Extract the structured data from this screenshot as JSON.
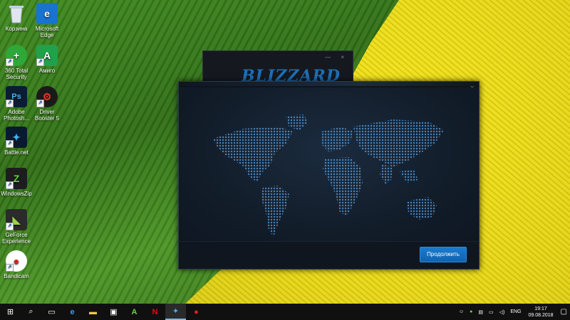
{
  "desktop": {
    "icons": [
      {
        "label": "Корзина",
        "icon": "recycle-bin-icon"
      },
      {
        "label": "Microsoft Edge",
        "icon": "edge-icon"
      },
      {
        "label": "360 Total Security",
        "icon": "360-security-icon"
      },
      {
        "label": "Амиго",
        "icon": "amigo-icon"
      },
      {
        "label": "Adobe Photosh...",
        "icon": "photoshop-icon"
      },
      {
        "label": "Driver Booster 5",
        "icon": "driver-booster-icon"
      },
      {
        "label": "Battle.net",
        "icon": "battlenet-icon"
      },
      {
        "label": "WindowsZip",
        "icon": "windowszip-icon"
      },
      {
        "label": "GeForce Experience",
        "icon": "geforce-icon"
      },
      {
        "label": "Bandicam",
        "icon": "bandicam-icon"
      }
    ]
  },
  "background_window": {
    "logo_text": "BLIZZARD"
  },
  "installer": {
    "close_glyph": "×",
    "continue_label": "Продолжить",
    "accent_color": "#1a7bd0"
  },
  "taskbar": {
    "items": [
      "start-icon",
      "search-icon",
      "task-view-icon",
      "edge-icon",
      "file-explorer-icon",
      "store-icon",
      "amigo-icon",
      "netflix-icon",
      "battlenet-icon",
      "bandicam-icon"
    ],
    "tray": {
      "language": "ENG",
      "time": "19:17",
      "date": "09.08.2018"
    }
  }
}
